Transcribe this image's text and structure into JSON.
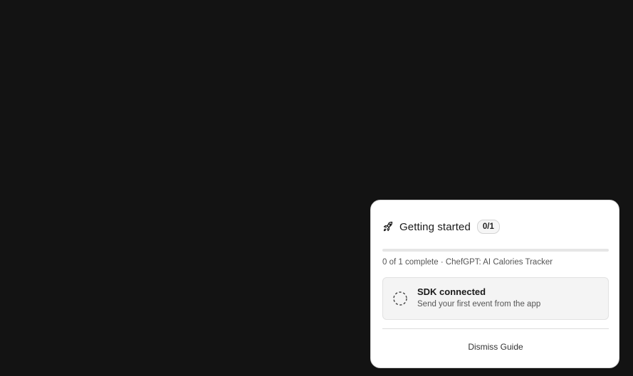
{
  "guide": {
    "title": "Getting started",
    "badge": "0/1",
    "progress_fraction": 0,
    "summary": "0 of 1 complete · ChefGPT: AI Calories Tracker",
    "steps": [
      {
        "title": "SDK connected",
        "description": "Send your first event from the app",
        "status": "pending",
        "icon": "dashed-circle-icon"
      }
    ],
    "dismiss_label": "Dismiss Guide",
    "header_icon": "rocket-icon"
  },
  "colors": {
    "background": "#131313",
    "card": "#ffffff",
    "step_background": "#f4f4f4"
  }
}
